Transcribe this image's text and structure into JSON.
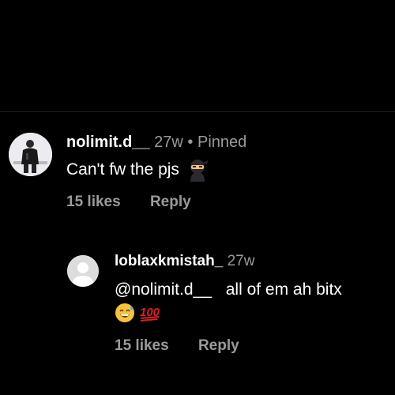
{
  "comments": [
    {
      "username": "nolimit.d__",
      "age": "27w",
      "separator": "•",
      "pinned_label": "Pinned",
      "text": "Can't fw the pjs",
      "emoji_icon": "ninja-icon",
      "likes": "15 likes",
      "reply_label": "Reply"
    },
    {
      "username": "loblaxkmistah_",
      "age": "27w",
      "mention": "@nolimit.d__",
      "text": "all of em ah bitx",
      "emoji_icons": [
        "sweat-smile-icon",
        "hundred-points-icon"
      ],
      "likes": "15 likes",
      "reply_label": "Reply"
    }
  ],
  "colors": {
    "background": "#000000",
    "primary_text": "#ffffff",
    "secondary_text": "#9a9a9a",
    "divider": "#1f1f1f"
  }
}
